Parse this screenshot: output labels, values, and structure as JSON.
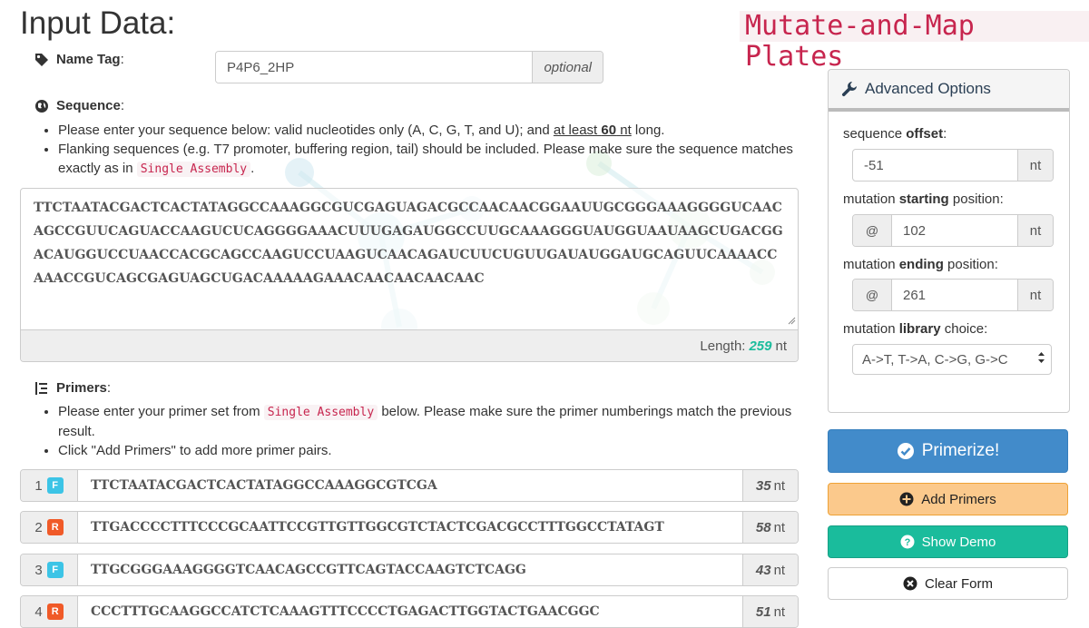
{
  "header": {
    "title": "Input Data:",
    "brand": "Mutate-and-Map Plates"
  },
  "name_tag": {
    "label": "Name Tag",
    "colon": ":",
    "value": "P4P6_2HP",
    "addon": "optional",
    "icon": "tag-icon"
  },
  "sequence": {
    "label": "Sequence",
    "colon": ":",
    "icon": "globe-icon",
    "note1_pre": "Please enter your sequence below: valid nucleotides only (A, C, G, T, and U); and ",
    "note1_u1": "at least ",
    "note1_u2": "60",
    "note1_u3": " nt",
    "note1_post": " long.",
    "note2_pre": "Flanking sequences (e.g. T7 promoter, buffering region, tail) should be included. Please make sure the sequence matches exactly as in ",
    "note2_code": "Single Assembly",
    "note2_post": ".",
    "value": "TTCTAATACGACTCACTATAGGCCAAAGGCGUCGAGUAGACGCCAACAACGGAAUUGCGGGAAAGGGGUCAACAGCCGUUCAGUACCAAGUCUCAGGGGAAACUUUGAGAUGGCCUUGCAAAGGGUAUGGUAAUAAGCUGACGGACAUGGUCCUAACCACGCAGCCAAGUCCUAAGUCAACAGAUCUUCUGUUGAUAUGGAUGCAGUUCAAAACCAAACCGUCAGCGAGUAGCUGACAAAAAGAAACAACAACAACAAC",
    "length_label": "Length:",
    "length_value": "259",
    "length_unit": "nt"
  },
  "primers": {
    "label": "Primers",
    "colon": ":",
    "icon": "list-tree-icon",
    "note1_pre": "Please enter your primer set from ",
    "note1_code": "Single Assembly",
    "note1_post": " below. Please make sure the primer numberings match the previous result.",
    "note2": "Click \"Add Primers\" to add more primer pairs.",
    "rows": [
      {
        "num": "1",
        "dir": "F",
        "seq": "TTCTAATACGACTCACTATAGGCCAAAGGCGTCGA",
        "len": "35",
        "unit": "nt"
      },
      {
        "num": "2",
        "dir": "R",
        "seq": "TTGACCCCTTTCCCGCAATTCCGTTGTTGGCGTCTACTCGACGCCTTTGGCCTATAGT",
        "len": "58",
        "unit": "nt"
      },
      {
        "num": "3",
        "dir": "F",
        "seq": "TTGCGGGAAAGGGGTCAACAGCCGTTCAGTACCAAGTCTCAGG",
        "len": "43",
        "unit": "nt"
      },
      {
        "num": "4",
        "dir": "R",
        "seq": "CCCTTTGCAAGGCCATCTCAAAGTTTCCCCTGAGACTTGGTACTGAACGGC",
        "len": "51",
        "unit": "nt"
      }
    ]
  },
  "advanced": {
    "title": "Advanced Options",
    "icon": "wrench-icon",
    "offset_label_pre": "sequence ",
    "offset_label_bold": "offset",
    "offset_label_post": ":",
    "offset_value": "-51",
    "offset_unit": "nt",
    "start_label_pre": "mutation ",
    "start_label_bold": "starting",
    "start_label_post": " position:",
    "start_prefix": "@",
    "start_value": "102",
    "start_unit": "nt",
    "end_label_pre": "mutation ",
    "end_label_bold": "ending",
    "end_label_post": " position:",
    "end_prefix": "@",
    "end_value": "261",
    "end_unit": "nt",
    "library_label_pre": "mutation ",
    "library_label_bold": "library",
    "library_label_post": " choice:",
    "library_value": "A->T, T->A, C->G, G->C"
  },
  "buttons": {
    "primerize": "Primerize!",
    "add_primers": "Add Primers",
    "show_demo": "Show Demo",
    "clear_form": "Clear Form"
  },
  "colors": {
    "primary": "#428bca",
    "warning": "#fbc98c",
    "success": "#1abc9c",
    "brand": "#c7254e",
    "forward_badge": "#3cc4e6",
    "reverse_badge": "#f05a28"
  }
}
